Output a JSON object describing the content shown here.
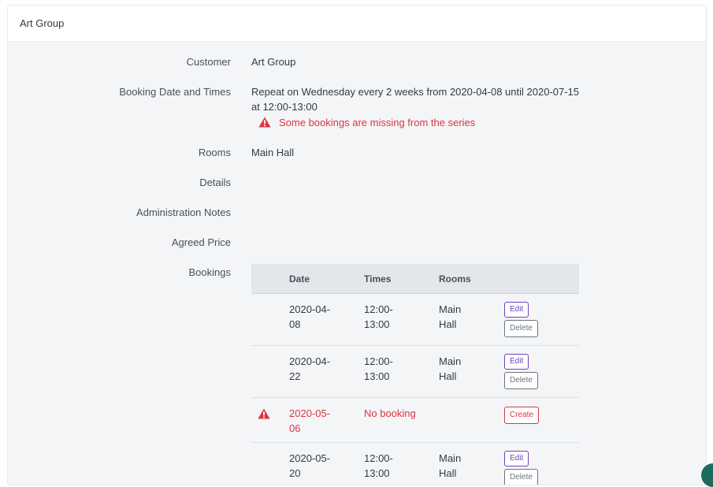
{
  "header": {
    "title": "Art Group"
  },
  "fields": {
    "customer": {
      "label": "Customer",
      "value": "Art Group"
    },
    "booking_times": {
      "label": "Booking Date and Times",
      "value_line1": "Repeat on Wednesday every 2 weeks from 2020-04-08 until 2020-07-15",
      "value_line2": "at 12:00-13:00",
      "warning": "Some bookings are missing from the series",
      "warning_icon": "warning-triangle-icon"
    },
    "rooms": {
      "label": "Rooms",
      "value": "Main Hall"
    },
    "details": {
      "label": "Details",
      "value": ""
    },
    "admin_notes": {
      "label": "Administration Notes",
      "value": ""
    },
    "agreed_price": {
      "label": "Agreed Price",
      "value": ""
    },
    "bookings": {
      "label": "Bookings"
    }
  },
  "bookings_table": {
    "columns": [
      "Date",
      "Times",
      "Rooms"
    ],
    "rows": [
      {
        "date_l1": "2020-04-",
        "date_l2": "08",
        "time_l1": "12:00-",
        "time_l2": "13:00",
        "room_l1": "Main",
        "room_l2": "Hall",
        "edit": "Edit",
        "delete": "Delete"
      },
      {
        "date_l1": "2020-04-",
        "date_l2": "22",
        "time_l1": "12:00-",
        "time_l2": "13:00",
        "room_l1": "Main",
        "room_l2": "Hall",
        "edit": "Edit",
        "delete": "Delete"
      },
      {
        "missing": true,
        "date_l1": "2020-05-",
        "date_l2": "06",
        "status": "No booking",
        "create": "Create"
      },
      {
        "date_l1": "2020-05-",
        "date_l2": "20",
        "time_l1": "12:00-",
        "time_l2": "13:00",
        "room_l1": "Main",
        "room_l2": "Hall",
        "edit": "Edit",
        "delete": "Delete"
      }
    ]
  },
  "colors": {
    "danger": "#dc3545",
    "edit": "#6f42c1",
    "muted": "#6c757d",
    "card_bg": "#f4f5f7",
    "table_head_bg": "#e3e6ea"
  }
}
